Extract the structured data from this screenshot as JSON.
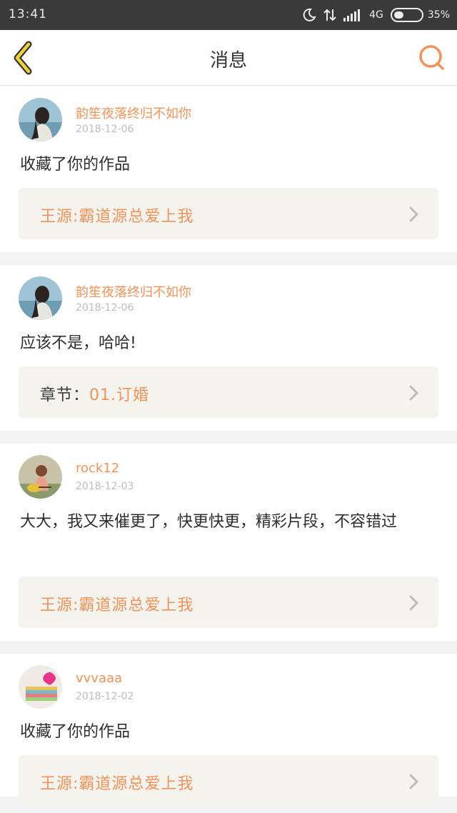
{
  "status_bar": {
    "time": "13:41",
    "network": "4G",
    "battery": "35%",
    "battery_level": 0.35
  },
  "header": {
    "title": "消息"
  },
  "colors": {
    "accent": "#f0935a",
    "back_arrow": "#ecd13a",
    "card_ref_bg": "#f4f3ee"
  },
  "messages": [
    {
      "username": "韵笙夜落终归不如你",
      "date": "2018-12-06",
      "text": "收藏了你的作品",
      "ref_prefix": "",
      "ref_text": "王源:霸道源总爱上我"
    },
    {
      "username": "韵笙夜落终归不如你",
      "date": "2018-12-06",
      "text": "应该不是，哈哈!",
      "ref_prefix": "章节：",
      "ref_text": "01.订婚"
    },
    {
      "username": "rock12",
      "date": "2018-12-03",
      "text": "大大，我又来催更了，快更快更，精彩片段，不容错过",
      "ref_prefix": "",
      "ref_text": "王源:霸道源总爱上我"
    },
    {
      "username": "vvvaaa",
      "date": "2018-12-02",
      "text": "收藏了你的作品",
      "ref_prefix": "",
      "ref_text": "王源:霸道源总爱上我"
    }
  ]
}
